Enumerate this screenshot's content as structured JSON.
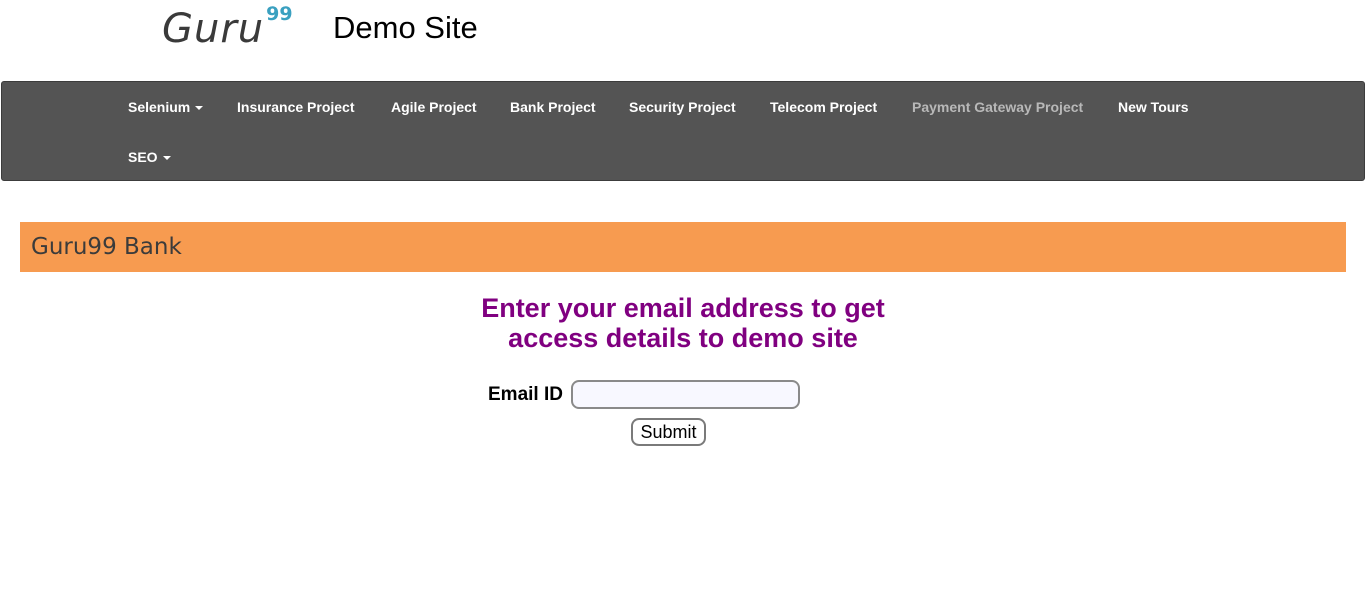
{
  "header": {
    "logo_text": "Guru",
    "logo_sup": "99",
    "site_title": "Demo Site"
  },
  "navbar": {
    "items": [
      {
        "label": "Selenium",
        "dropdown": true
      },
      {
        "label": "Insurance Project"
      },
      {
        "label": "Agile Project"
      },
      {
        "label": "Bank Project"
      },
      {
        "label": "Security Project"
      },
      {
        "label": "Telecom Project"
      },
      {
        "label": "Payment Gateway Project",
        "active": true
      },
      {
        "label": "New Tours"
      },
      {
        "label": "SEO",
        "dropdown": true
      }
    ]
  },
  "bank": {
    "title": "Guru99 Bank"
  },
  "form": {
    "prompt_line1": "Enter your email address to get",
    "prompt_line2": "access details to demo site",
    "email_label": "Email ID",
    "email_value": "",
    "submit_label": "Submit"
  },
  "colors": {
    "navbar_bg": "#545454",
    "bank_bar_bg": "#f79b50",
    "prompt_color": "#800080",
    "logo_accent": "#3aa0c0"
  }
}
